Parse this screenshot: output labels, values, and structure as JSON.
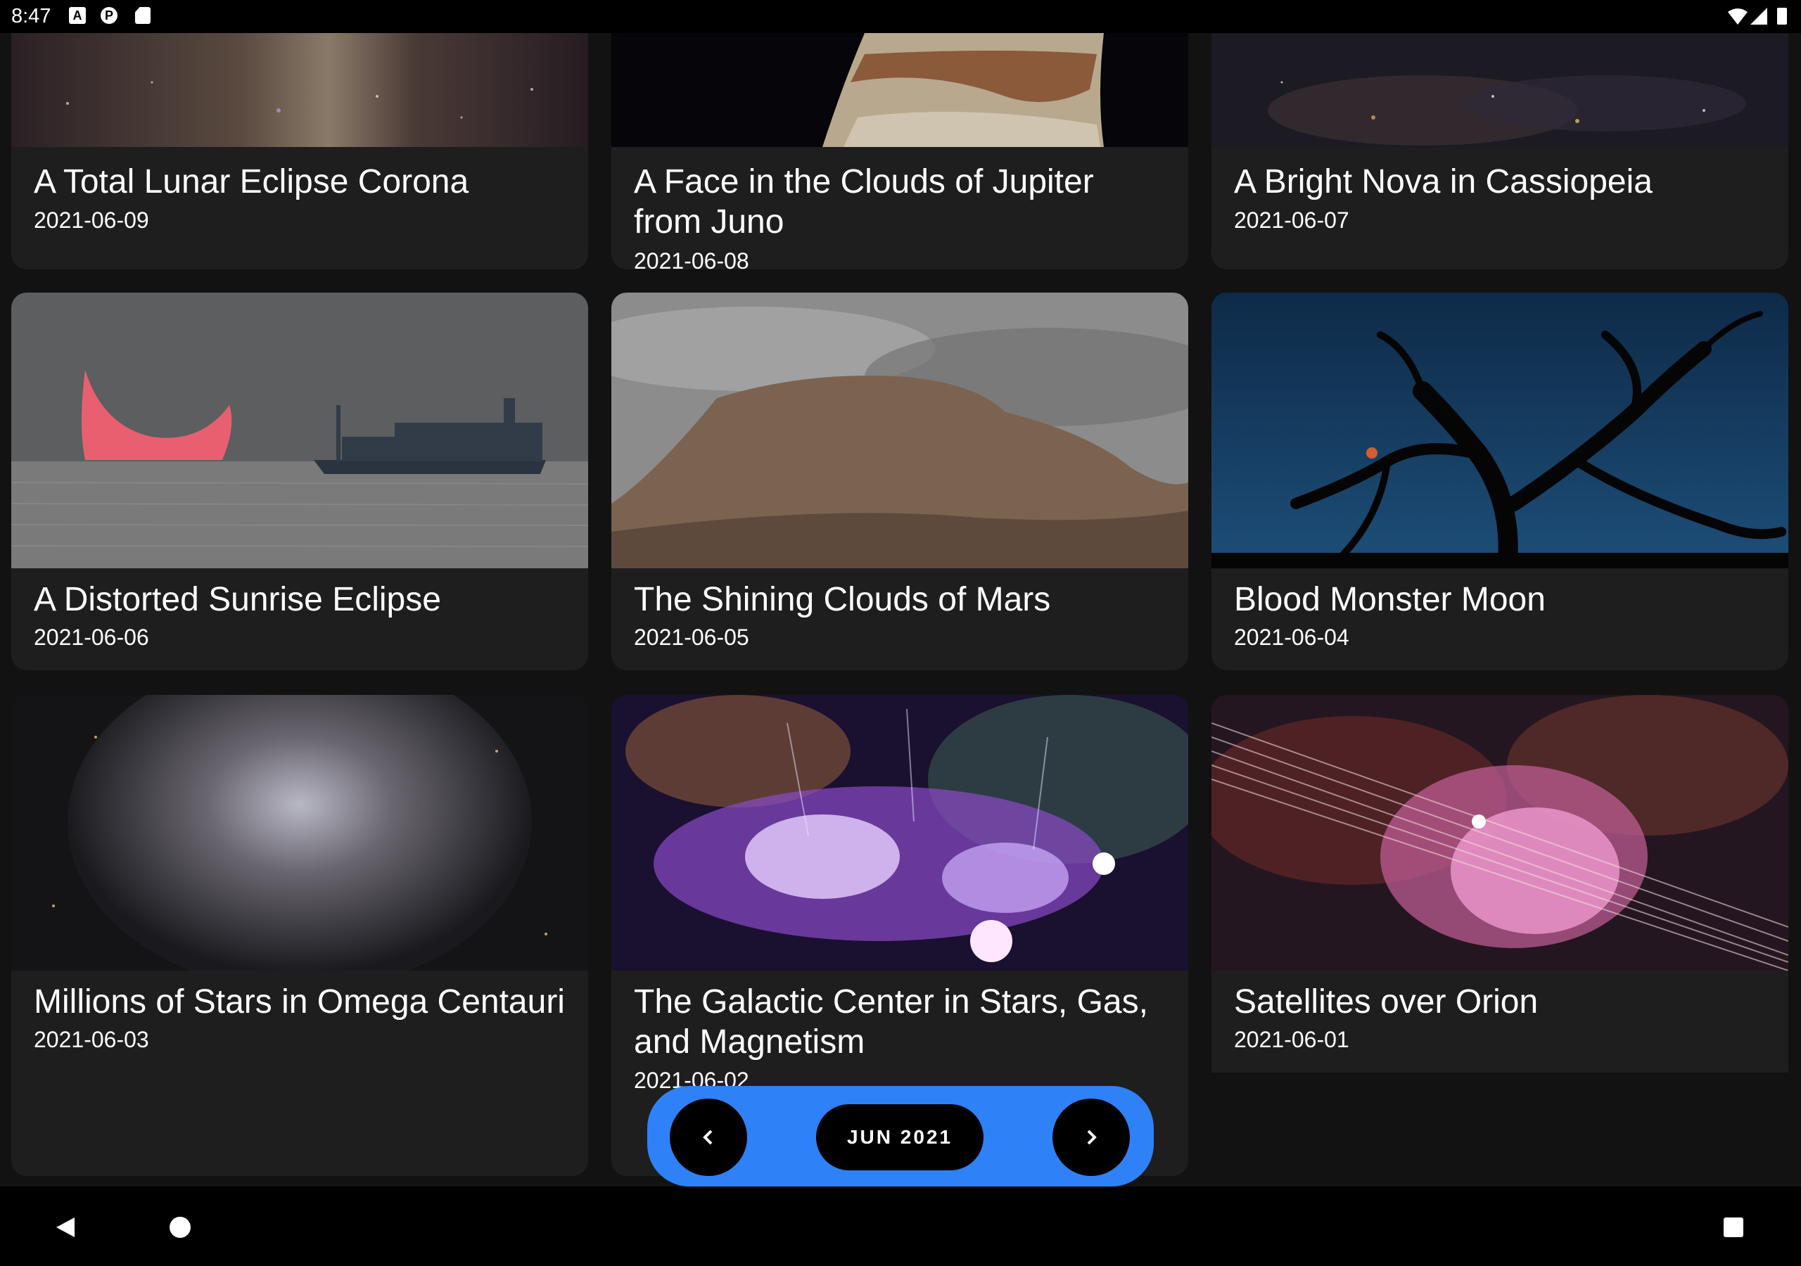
{
  "status_bar": {
    "time": "8:47",
    "icons": [
      "a-notification-icon",
      "app-icon",
      "sd-card-icon"
    ],
    "right_icons": [
      "wifi-icon",
      "signal-icon",
      "battery-icon"
    ]
  },
  "cards": [
    {
      "title": "A Total Lunar Eclipse Corona",
      "date": "2021-06-09"
    },
    {
      "title": "A Face in the Clouds of Jupiter from Juno",
      "date": "2021-06-08"
    },
    {
      "title": "A Bright Nova in Cassiopeia",
      "date": "2021-06-07"
    },
    {
      "title": "A Distorted Sunrise Eclipse",
      "date": "2021-06-06"
    },
    {
      "title": "The Shining Clouds of Mars",
      "date": "2021-06-05"
    },
    {
      "title": "Blood Monster Moon",
      "date": "2021-06-04"
    },
    {
      "title": "Millions of Stars in Omega Centauri",
      "date": "2021-06-03"
    },
    {
      "title": "The Galactic Center in Stars, Gas, and Magnetism",
      "date": "2021-06-02"
    },
    {
      "title": "Satellites over Orion",
      "date": "2021-06-01"
    }
  ],
  "pager": {
    "month": "JUN 2021",
    "prev_icon": "chevron-left-icon",
    "next_icon": "chevron-right-icon",
    "accent": "#2f81f7"
  },
  "nav_bar": {
    "back": "back-icon",
    "home": "home-icon",
    "recents": "recents-icon"
  }
}
